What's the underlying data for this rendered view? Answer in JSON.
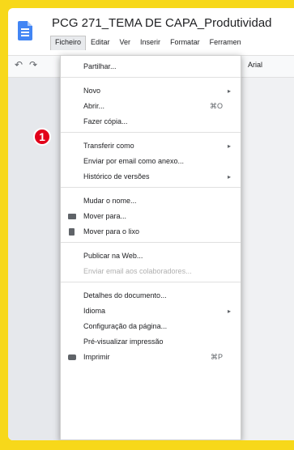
{
  "window": {
    "title": "PCG 271_TEMA DE CAPA_Produtividad"
  },
  "menubar": [
    "Ficheiro",
    "Editar",
    "Ver",
    "Inserir",
    "Formatar",
    "Ferramen"
  ],
  "toolbar": {
    "font_name": "Arial"
  },
  "file_menu": {
    "items": [
      {
        "label": "Partilhar..."
      },
      {
        "label": "Novo",
        "submenu": true
      },
      {
        "label": "Abrir...",
        "shortcut": "⌘O"
      },
      {
        "label": "Fazer cópia..."
      },
      {
        "label": "Transferir como",
        "submenu": true
      },
      {
        "label": "Enviar por email como anexo..."
      },
      {
        "label": "Histórico de versões",
        "submenu": true
      },
      {
        "label": "Mudar o nome..."
      },
      {
        "label": "Mover para...",
        "icon": "folder-icon"
      },
      {
        "label": "Mover para o lixo",
        "icon": "trash-icon"
      },
      {
        "label": "Publicar na Web..."
      },
      {
        "label": "Enviar email aos colaboradores...",
        "disabled": true
      },
      {
        "label": "Detalhes do documento..."
      },
      {
        "label": "Idioma",
        "submenu": true
      },
      {
        "label": "Configuração da página..."
      },
      {
        "label": "Pré-visualizar impressão"
      },
      {
        "label": "Imprimir",
        "shortcut": "⌘P",
        "icon": "print-icon"
      }
    ]
  },
  "annotation": {
    "badge_number": "1",
    "badge_color": "#e2001a"
  },
  "colors": {
    "background": "#f7d81a",
    "doc_icon": "#4285f4"
  },
  "icons": {
    "submenu_arrow": "▸"
  }
}
